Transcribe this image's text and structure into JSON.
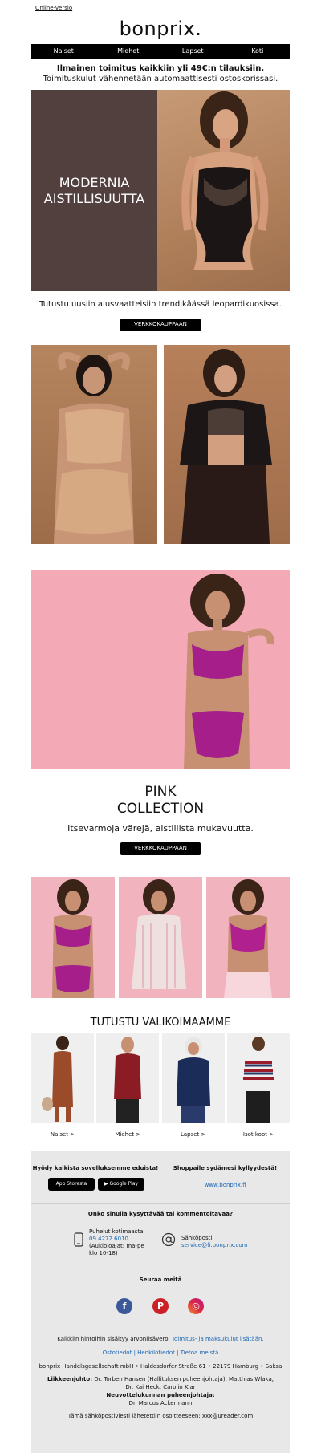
{
  "top": {
    "online_version": "Online-versio"
  },
  "header": {
    "logo": "bonprix."
  },
  "nav": {
    "items": [
      "Naiset",
      "Miehet",
      "Lapset",
      "Koti"
    ]
  },
  "shipping": {
    "bold": "Ilmainen toimitus kaikkiin yli 49€:n tilauksiin.",
    "rest": "Toimituskulut vähennetään automaattisesti ostoskorissasi."
  },
  "hero": {
    "title_line1": "MODERNIA",
    "title_line2": "AISTILLISUUTTA",
    "text": "Tutustu uusiin alusvaatteisiin trendikäässä leopardikuosissa.",
    "button": "VERKKOKAUPPAAN"
  },
  "pink": {
    "title_line1": "PINK",
    "title_line2": "COLLECTION",
    "text": "Itsevarmoja värejä, aistillista mukavuutta.",
    "button": "VERKKOKAUPPAAN"
  },
  "categories": {
    "title": "TUTUSTU VALIKOIMAAMME",
    "items": [
      "Naiset >",
      "Miehet >",
      "Lapset >",
      "Isot koot >"
    ]
  },
  "footer": {
    "app_title": "Hyödy kaikista sovelluksemme eduista!",
    "app_store": "App Storesta",
    "google_play": "Google Play",
    "fav_title": "Shoppaile sydämesi kyllyydestä!",
    "fav_link": "www.bonprix.fi",
    "questions": "Onko sinulla kysyttävää tai kommentoitavaa?",
    "phone_label": "Puhelut kotimaasta",
    "phone_number": "09 4272 6010",
    "phone_hours": "(Aukioloajat: ma-pe klo 10-18)",
    "email_label": "Sähköposti",
    "email": "service@fi.bonprix.com",
    "follow": "Seuraa meitä",
    "vat_text": "Kaikkiin hintoihin sisältyy arvonlisävero.",
    "vat_link": "Toimitus- ja maksukulut lisätään.",
    "links": [
      "Ostotiedot",
      "Henkilötiedot",
      "Tietoa meistä"
    ],
    "address": "bonprix Handelsgesellschaft mbH • Haldesdorfer Straße 61 • 22179 Hamburg • Saksa",
    "mgmt_label": "Liikkeenjohto:",
    "mgmt_names": "Dr. Torben Hansen (Hallituksen puheenjohtaja), Matthias Wlaka, Dr. Kai Heck, Carolin Klar",
    "board_label": "Neuvottelukunnan puheenjohtaja:",
    "board_name": "Dr. Marcus Ackermann",
    "sent_to": "Tämä sähköpostiviesti lähetettiin osoitteeseen: xxx@ureader.com"
  },
  "colors": {
    "hero_panel": "#52403f",
    "pink_bg": "#f4a9b6",
    "link": "#1a66b3",
    "footer_bg": "#e8e8e8"
  }
}
